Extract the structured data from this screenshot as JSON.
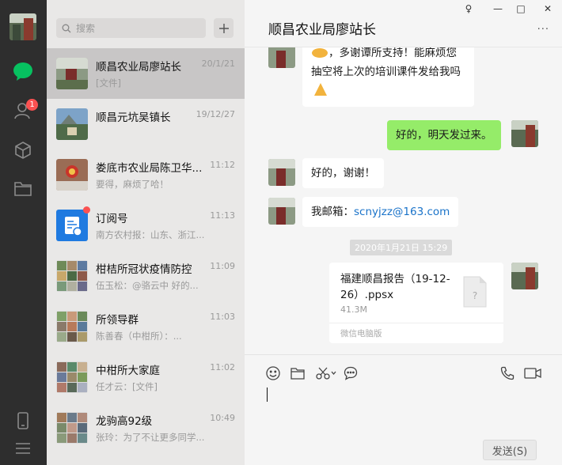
{
  "window_controls": {
    "pin": "♀",
    "minimize": "—",
    "maximize": "□",
    "close": "✕"
  },
  "rail": {
    "icons": [
      "avatar",
      "chat-icon",
      "contacts-icon",
      "mini-program-icon",
      "folder-icon",
      "phone-icon",
      "menu-icon"
    ],
    "contacts_badge": "1",
    "active": "chat-icon",
    "accent": "#07c160"
  },
  "search": {
    "placeholder": "搜索"
  },
  "conversations": [
    {
      "name": "顺昌农业局廖站长",
      "time": "20/1/21",
      "preview": "[文件]",
      "active": true
    },
    {
      "name": "顺昌元坑吴镇长",
      "time": "19/12/27",
      "preview": ""
    },
    {
      "name": "娄底市农业局陈卫华...",
      "time": "11:12",
      "preview": "要得，麻烦了哈！"
    },
    {
      "name": "订阅号",
      "time": "11:13",
      "preview": "南方农村报：山东、浙江...",
      "red_dot": true
    },
    {
      "name": "柑桔所冠状疫情防控",
      "time": "11:09",
      "preview": "伍玉松：@骆云中 好的..."
    },
    {
      "name": "所领导群",
      "time": "11:03",
      "preview": "陈善春（中柑所）：..."
    },
    {
      "name": "中柑所大家庭",
      "time": "11:02",
      "preview": "任才云：[文件]"
    },
    {
      "name": "龙驹高92级",
      "time": "10:49",
      "preview": "张玲：为了不让更多同学..."
    }
  ],
  "chat": {
    "title": "顺昌农业局廖站长",
    "more": "···",
    "messages": {
      "m1_line1": "，多谢谭所支持！能麻烦您",
      "m1_line2": "抽空将上次的培训课件发给我吗",
      "m2": "好的，明天发过来。",
      "m3": "好的，谢谢！",
      "m4_prefix": "我邮箱：",
      "m4_email": "scnyjzz@163.com",
      "timestamp": "2020年1月21日 15:29",
      "file_name": "福建顺昌报告（19-12-26）.ppsx",
      "file_size": "41.3M",
      "file_source": "微信电脑版"
    },
    "email_color": "#1a73c9",
    "my_bubble_color": "#95ec69"
  },
  "toolbar": {
    "icons": [
      "emoji-icon",
      "folder-icon",
      "scissors-icon",
      "chat-bubble-icon",
      "phone-icon",
      "video-icon"
    ],
    "send_label": "发送(S)"
  }
}
